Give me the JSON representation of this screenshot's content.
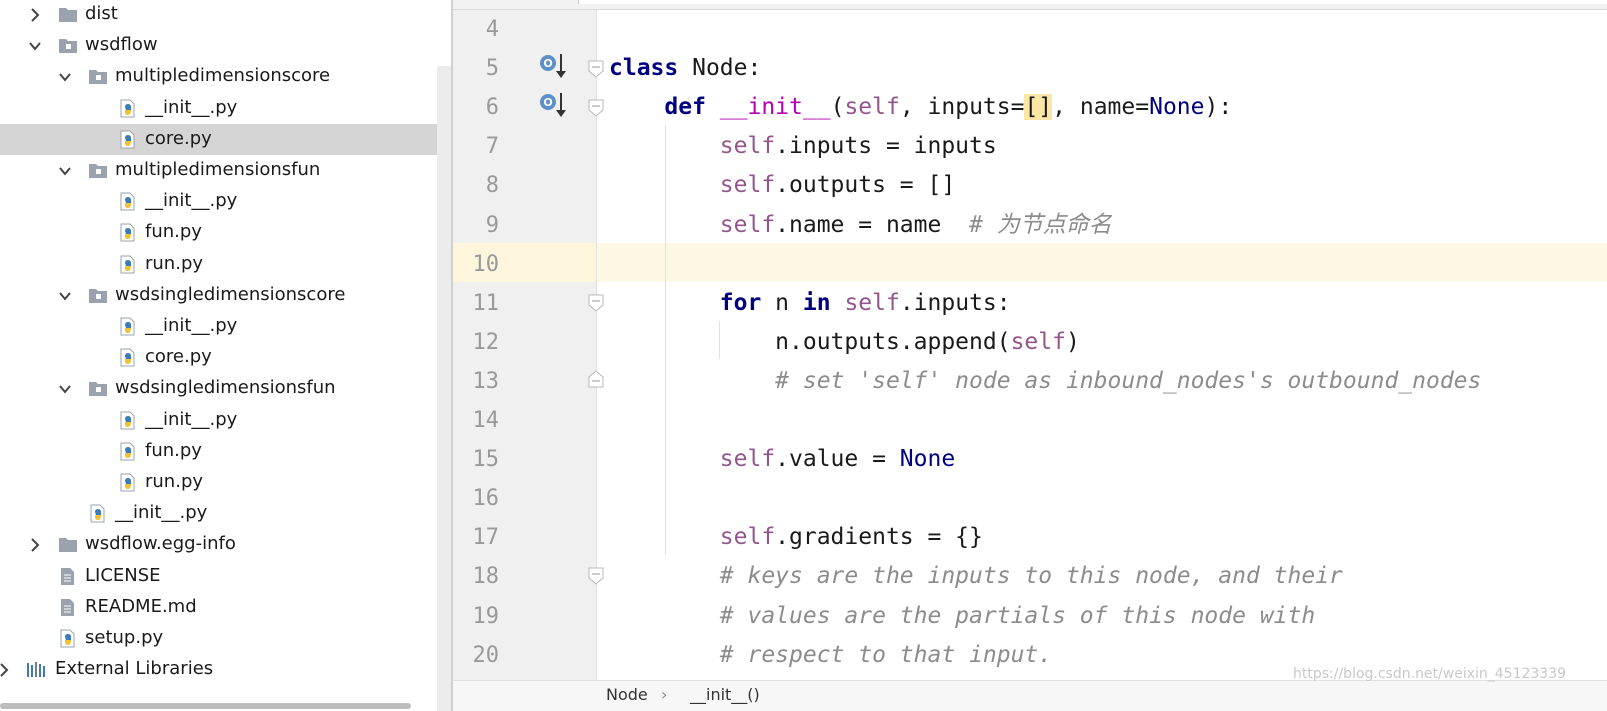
{
  "tree": {
    "items": [
      {
        "label": "dist",
        "kind": "folder",
        "expanded": false,
        "selected": false
      },
      {
        "label": "wsdflow",
        "kind": "package",
        "expanded": true,
        "selected": false
      },
      {
        "label": "multipledimensionscore",
        "kind": "package",
        "expanded": true,
        "selected": false
      },
      {
        "label": "__init__.py",
        "kind": "python-file",
        "selected": false
      },
      {
        "label": "core.py",
        "kind": "python-file",
        "selected": true
      },
      {
        "label": "multipledimensionsfun",
        "kind": "package",
        "expanded": true,
        "selected": false
      },
      {
        "label": "__init__.py",
        "kind": "python-file",
        "selected": false
      },
      {
        "label": "fun.py",
        "kind": "python-file",
        "selected": false
      },
      {
        "label": "run.py",
        "kind": "python-file",
        "selected": false
      },
      {
        "label": "wsdsingledimensionscore",
        "kind": "package",
        "expanded": true,
        "selected": false
      },
      {
        "label": "__init__.py",
        "kind": "python-file",
        "selected": false
      },
      {
        "label": "core.py",
        "kind": "python-file",
        "selected": false
      },
      {
        "label": "wsdsingledimensionsfun",
        "kind": "package",
        "expanded": true,
        "selected": false
      },
      {
        "label": "__init__.py",
        "kind": "python-file",
        "selected": false
      },
      {
        "label": "fun.py",
        "kind": "python-file",
        "selected": false
      },
      {
        "label": "run.py",
        "kind": "python-file",
        "selected": false
      },
      {
        "label": "__init__.py",
        "kind": "python-file",
        "selected": false
      },
      {
        "label": "wsdflow.egg-info",
        "kind": "folder",
        "expanded": false,
        "selected": false
      },
      {
        "label": "LICENSE",
        "kind": "text-file",
        "selected": false
      },
      {
        "label": "README.md",
        "kind": "text-file",
        "selected": false
      },
      {
        "label": "setup.py",
        "kind": "python-file",
        "selected": false
      },
      {
        "label": "External Libraries",
        "kind": "libraries",
        "expanded": false,
        "selected": false
      }
    ]
  },
  "editor": {
    "lines": [
      {
        "num": "4",
        "text": ""
      },
      {
        "num": "5",
        "text": "class Node:"
      },
      {
        "num": "6",
        "text": "    def __init__(self, inputs=[], name=None):"
      },
      {
        "num": "7",
        "text": "        self.inputs = inputs"
      },
      {
        "num": "8",
        "text": "        self.outputs = []"
      },
      {
        "num": "9",
        "text": "        self.name = name  # 为节点命名"
      },
      {
        "num": "10",
        "text": ""
      },
      {
        "num": "11",
        "text": "        for n in self.inputs:"
      },
      {
        "num": "12",
        "text": "            n.outputs.append(self)"
      },
      {
        "num": "13",
        "text": "            # set 'self' node as inbound_nodes's outbound_nodes"
      },
      {
        "num": "14",
        "text": ""
      },
      {
        "num": "15",
        "text": "        self.value = None"
      },
      {
        "num": "16",
        "text": ""
      },
      {
        "num": "17",
        "text": "        self.gradients = {}"
      },
      {
        "num": "18",
        "text": "        # keys are the inputs to this node, and their"
      },
      {
        "num": "19",
        "text": "        # values are the partials of this node with"
      },
      {
        "num": "20",
        "text": "        # respect to that input."
      }
    ],
    "current_line": "10",
    "breadcrumb": [
      "Node",
      "__init__()"
    ],
    "breadcrumb_sep": "›",
    "watermark": "https://blog.csdn.net/weixin_45123339"
  },
  "colors": {
    "keyword": "#000080",
    "self": "#94558d",
    "dunder": "#b200b2",
    "comment": "#8c8c8c",
    "selection": "#d5d5d5",
    "current_line": "#fdf8e4",
    "bracket_highlight": "#fbe7a4"
  },
  "icons": {
    "folder": "folder-icon",
    "package": "package-icon",
    "python-file": "python-file-icon",
    "text-file": "text-file-icon",
    "libraries": "libraries-icon",
    "override": "override-marker-icon",
    "fold": "fold-marker-icon"
  }
}
